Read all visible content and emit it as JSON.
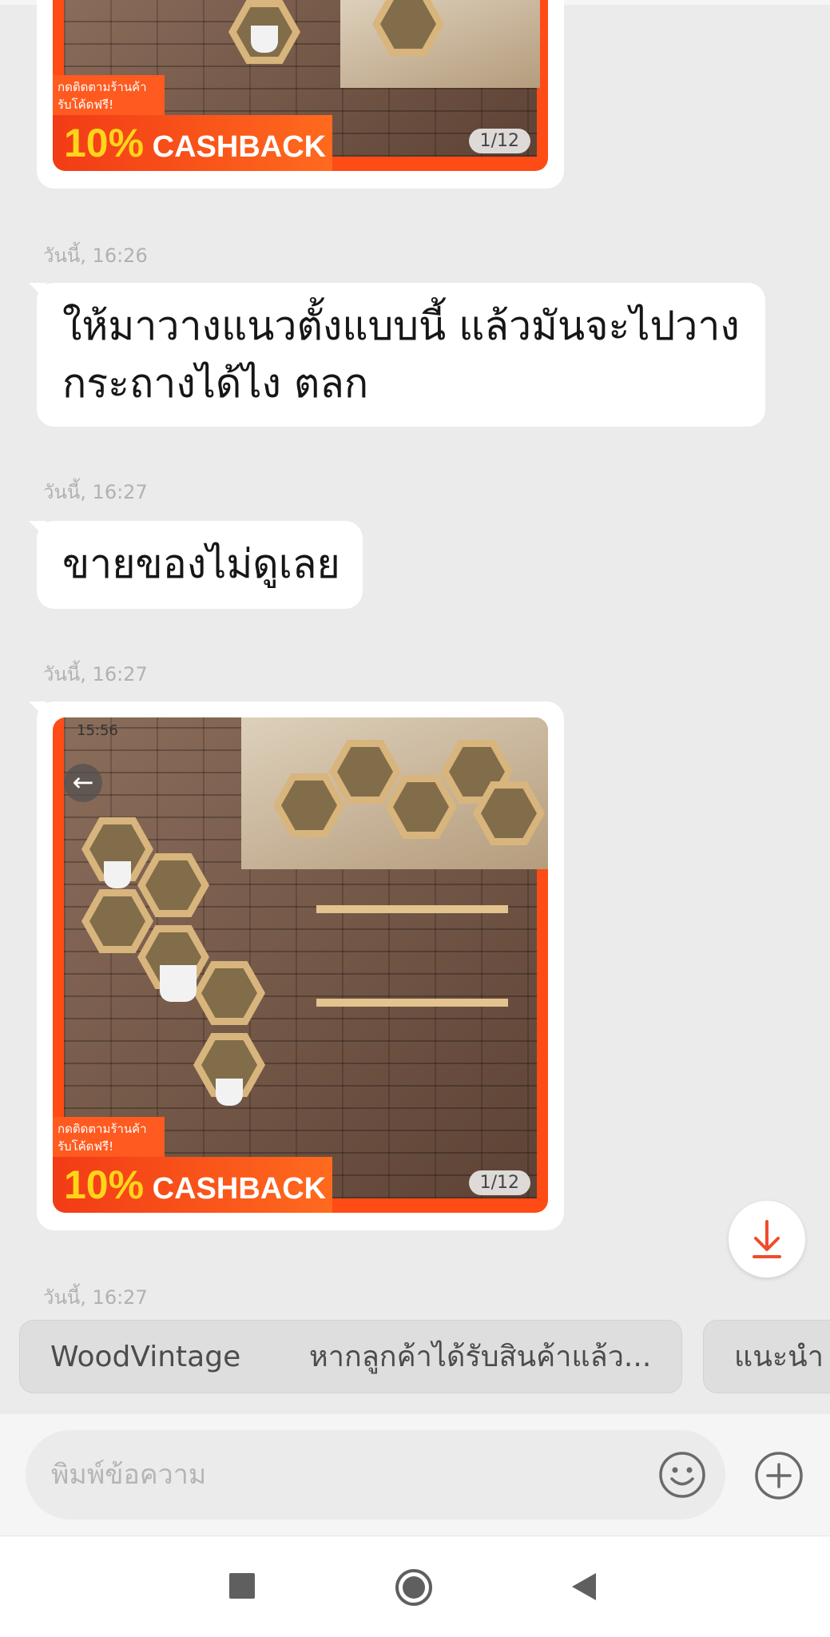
{
  "messages": [
    {
      "type": "product",
      "timestamp": "",
      "counter": "1/12",
      "promo_line1": "กดติดตามร้านค้า",
      "promo_line2": "รับโค้ดฟรี!",
      "cashback_pct": "10%",
      "cashback_word": "CASHBACK"
    },
    {
      "type": "text",
      "timestamp": "วันนี้, 16:26",
      "lines": [
        "ให้มาวางแนวตั้งแบบนี้ แล้วมันจะไปวาง",
        "กระถางได้ไง ตลก"
      ]
    },
    {
      "type": "text",
      "timestamp": "วันนี้, 16:27",
      "lines": [
        "ขายของไม่ดูเลย"
      ]
    },
    {
      "type": "product",
      "timestamp": "วันนี้, 16:27",
      "status_time": "15:56",
      "counter": "1/12",
      "promo_line1": "กดติดตามร้านค้า",
      "promo_line2": "รับโค้ดฟรี!",
      "cashback_pct": "10%",
      "cashback_word": "CASHBACK"
    },
    {
      "type": "timestamp_only",
      "timestamp": "วันนี้, 16:27"
    }
  ],
  "quick_replies": [
    {
      "label": "WoodVintage"
    },
    {
      "label": "หากลูกค้าได้รับสินค้าแล้ว..."
    },
    {
      "label": "แนะนำ"
    }
  ],
  "composer": {
    "placeholder": "พิมพ์ข้อความ",
    "emoji_icon": "smiley-icon",
    "add_icon": "plus-circle-icon"
  },
  "scroll_button": {
    "icon": "download-arrow-icon"
  },
  "colors": {
    "accent": "#ee4d2d",
    "background": "#ebebeb",
    "bubble": "#ffffff"
  },
  "nav": {
    "icons": [
      "recent-apps-icon",
      "home-icon",
      "back-icon"
    ]
  }
}
